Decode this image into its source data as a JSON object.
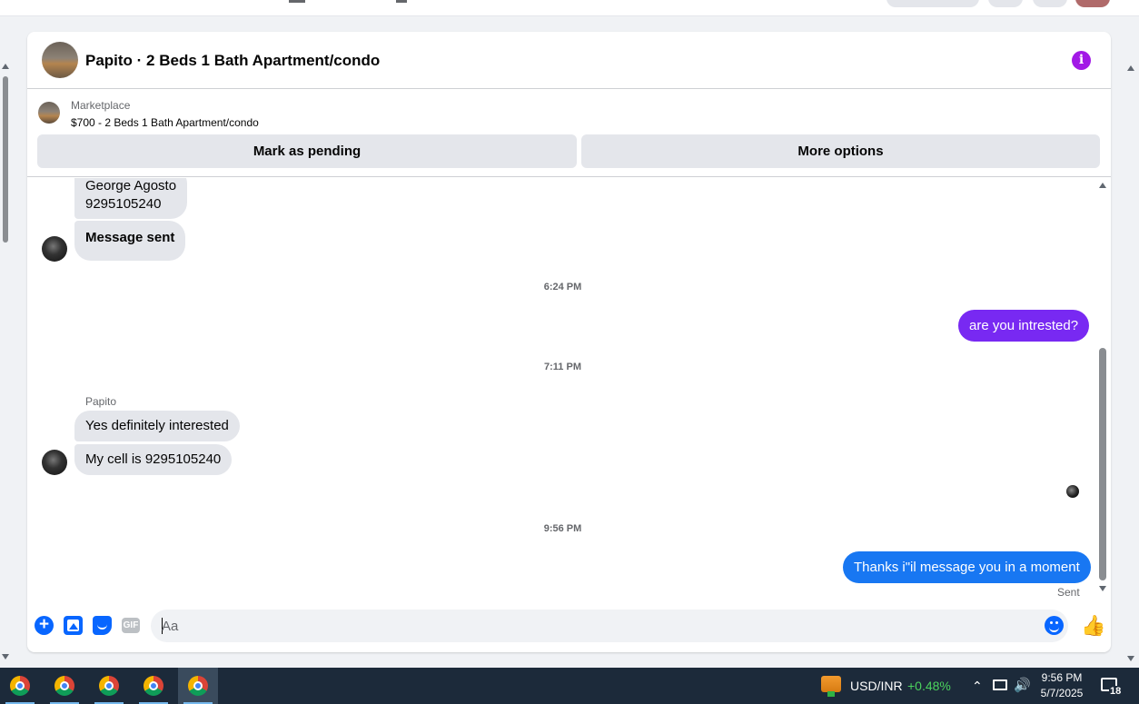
{
  "chat": {
    "title": "Papito · 2 Beds 1 Bath Apartment/condo",
    "info_icon": "info-icon",
    "accent_color": "#a219e6"
  },
  "listing": {
    "source": "Marketplace",
    "name": "$700 - 2 Beds 1 Bath Apartment/condo",
    "pending_label": "Mark as pending",
    "more_label": "More options"
  },
  "messages": {
    "m1_line1": "George Agosto",
    "m1_line2": "9295105240",
    "m2": "Message sent",
    "ts1": "6:24 PM",
    "m3": "are you intrested?",
    "ts2": "7:11 PM",
    "sender_name": "Papito",
    "m4": "Yes definitely interested",
    "m5": "My cell is 9295105240",
    "ts3": "9:56 PM",
    "m6": "Thanks i\"il message you in a moment",
    "status": "Sent"
  },
  "composer": {
    "placeholder": "Aa",
    "gif_label": "GIF"
  },
  "taskbar": {
    "ticker_name": "USD/INR",
    "ticker_change": "+0.48%",
    "time": "9:56 PM",
    "date": "5/7/2025",
    "notification_count": "18",
    "apps": [
      "chrome-icon",
      "chrome-icon",
      "chrome-icon",
      "chrome-icon",
      "chrome-icon"
    ]
  }
}
